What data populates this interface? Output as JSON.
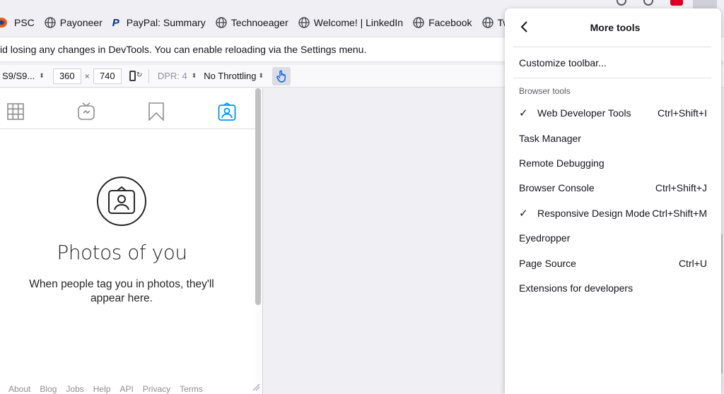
{
  "bookmarks": [
    {
      "label": "PSC",
      "icon": "psc-icon"
    },
    {
      "label": "Payoneer",
      "icon": "globe-icon"
    },
    {
      "label": "PayPal: Summary",
      "icon": "paypal-icon"
    },
    {
      "label": "Technoeager",
      "icon": "globe-icon"
    },
    {
      "label": "Welcome! | LinkedIn",
      "icon": "globe-icon"
    },
    {
      "label": "Facebook",
      "icon": "globe-icon"
    },
    {
      "label": "Twitter",
      "icon": "globe-icon"
    }
  ],
  "notice": {
    "text": "id losing any changes in DevTools. You can enable reloading via the Settings menu."
  },
  "rdm": {
    "device": "S9/S9...",
    "width": "360",
    "times": "×",
    "height": "740",
    "dpr": "DPR: 4",
    "throttling": "No Throttling",
    "caret": "⬍"
  },
  "page": {
    "title": "Photos of you",
    "subtitle": "When people tag you in photos, they'll appear here.",
    "footer": [
      "About",
      "Blog",
      "Jobs",
      "Help",
      "API",
      "Privacy",
      "Terms"
    ]
  },
  "panel": {
    "title": "More tools",
    "customize": "Customize toolbar...",
    "section": "Browser tools",
    "items": [
      {
        "label": "Web Developer Tools",
        "shortcut": "Ctrl+Shift+I",
        "checked": "✓"
      },
      {
        "label": "Task Manager",
        "shortcut": "",
        "checked": ""
      },
      {
        "label": "Remote Debugging",
        "shortcut": "",
        "checked": ""
      },
      {
        "label": "Browser Console",
        "shortcut": "Ctrl+Shift+J",
        "checked": ""
      },
      {
        "label": "Responsive Design Mode",
        "shortcut": "Ctrl+Shift+M",
        "checked": "✓"
      },
      {
        "label": "Eyedropper",
        "shortcut": "",
        "checked": ""
      },
      {
        "label": "Page Source",
        "shortcut": "Ctrl+U",
        "checked": ""
      },
      {
        "label": "Extensions for developers",
        "shortcut": "",
        "checked": ""
      }
    ]
  },
  "colors": {
    "accent": "#0060df",
    "instagram_active": "#0095f6",
    "text": "#15141a"
  }
}
